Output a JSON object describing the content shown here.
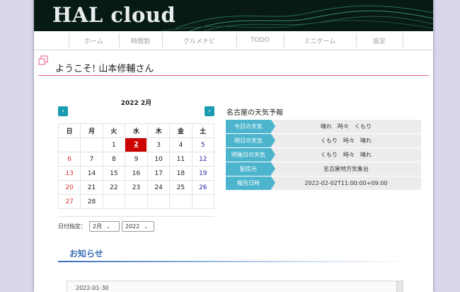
{
  "app": {
    "logo": "HAL cloud"
  },
  "nav": {
    "items": [
      {
        "label": "ホーム"
      },
      {
        "label": "時間割"
      },
      {
        "label": "グルメナビ"
      },
      {
        "label": "TODO"
      },
      {
        "label": "ミニゲーム"
      },
      {
        "label": "設定"
      }
    ]
  },
  "welcome": {
    "text": "ようこそ! 山本修輔さん"
  },
  "calendar": {
    "title": "2022 2月",
    "prev": "‹",
    "next": "›",
    "weekdays": [
      "日",
      "月",
      "火",
      "水",
      "木",
      "金",
      "土"
    ],
    "weeks": [
      [
        "",
        "",
        "1",
        "2",
        "3",
        "4",
        "5"
      ],
      [
        "6",
        "7",
        "8",
        "9",
        "10",
        "11",
        "12"
      ],
      [
        "13",
        "14",
        "15",
        "16",
        "17",
        "18",
        "19"
      ],
      [
        "20",
        "21",
        "22",
        "23",
        "24",
        "25",
        "26"
      ],
      [
        "27",
        "28",
        "",
        "",
        "",
        "",
        ""
      ]
    ],
    "today": "2",
    "date_label": "日付指定：",
    "month_select": "2月",
    "year_select": "2022"
  },
  "weather": {
    "title": "名古屋の天気予報",
    "rows": [
      {
        "key": "今日の天気",
        "value": "晴れ　時々　くもり"
      },
      {
        "key": "明日の天気",
        "value": "くもり　時々　晴れ"
      },
      {
        "key": "明後日の天気",
        "value": "くもり　時々　晴れ"
      },
      {
        "key": "配信元",
        "value": "名古屋地方気象台"
      },
      {
        "key": "報告日時",
        "value": "2022-02-02T11:00:00+09:00"
      }
    ]
  },
  "news": {
    "title": "お知らせ",
    "items": [
      {
        "date": "2022-01-30"
      }
    ]
  },
  "colors": {
    "accent": "#1a9bb1",
    "today": "#cc0000",
    "divider": "#e35b84",
    "news": "#3a6fb4"
  }
}
